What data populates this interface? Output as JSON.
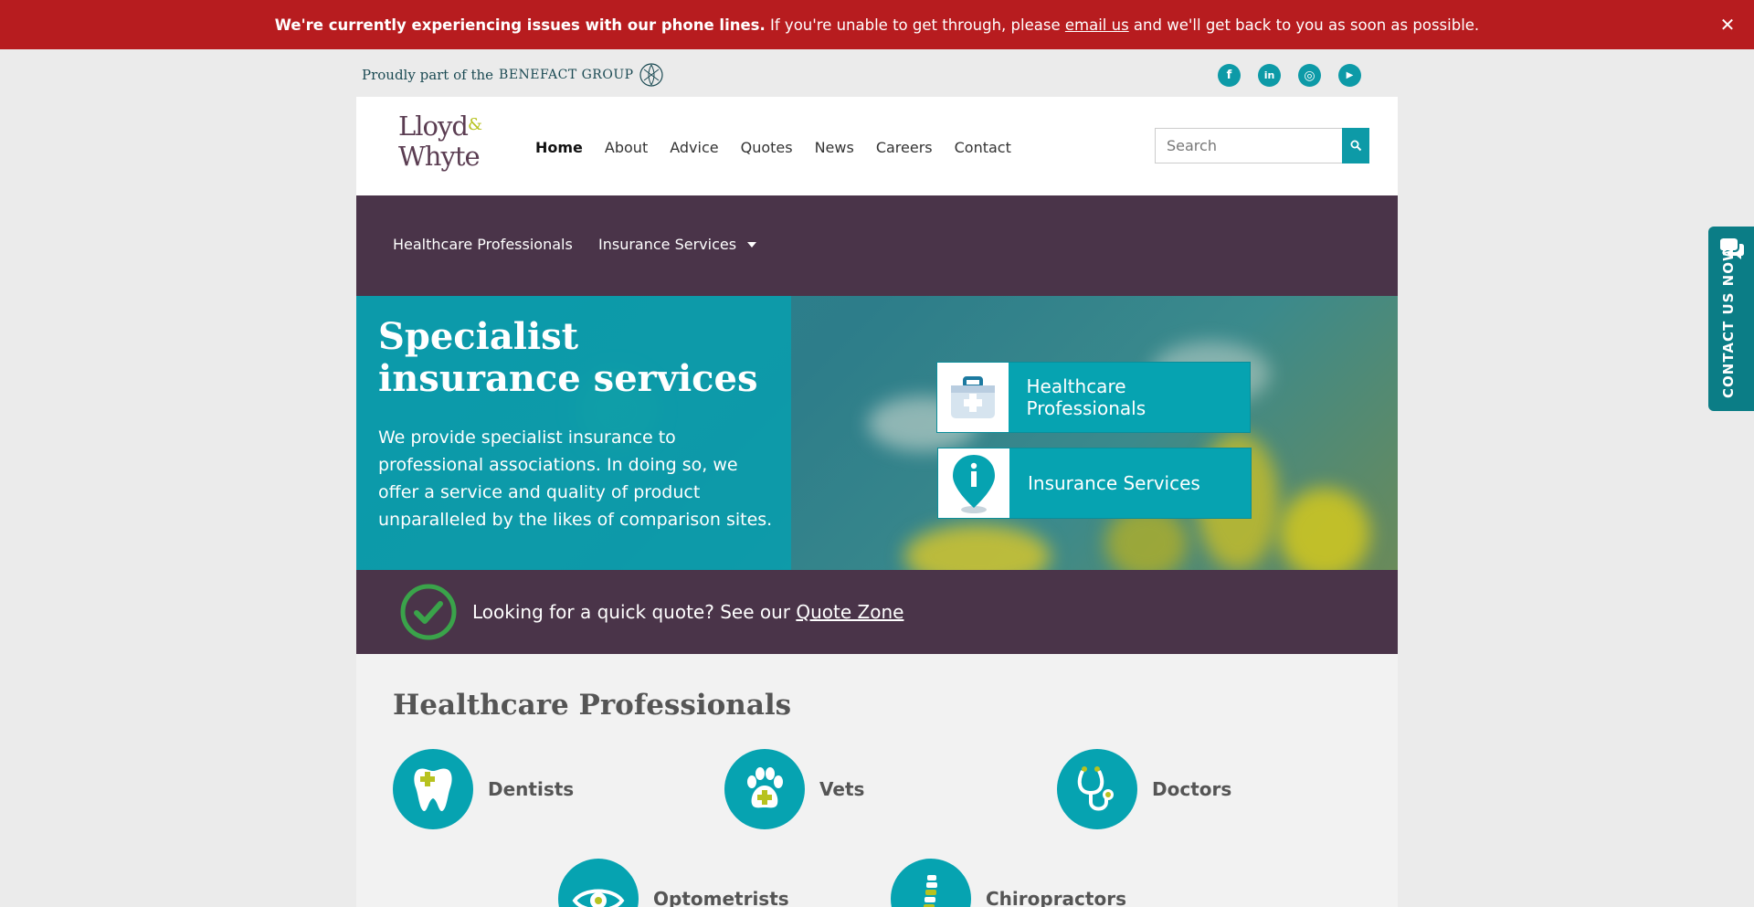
{
  "alert": {
    "bold_text": "We're currently experiencing issues with our phone lines.",
    "text_before_link": " If you're unable to get through, please ",
    "link_text": "email us",
    "text_after_link": " and we'll get back to you as soon as possible.",
    "close_icon": "close-icon"
  },
  "topstrip": {
    "group_prefix": "Proudly part of the",
    "group_name": "BENEFACT GROUP",
    "socials": [
      {
        "name": "facebook-icon",
        "glyph": "f"
      },
      {
        "name": "linkedin-icon",
        "glyph": "in"
      },
      {
        "name": "instagram-icon",
        "glyph": "◎"
      },
      {
        "name": "youtube-icon",
        "glyph": "▶"
      }
    ]
  },
  "header": {
    "logo_line1": "Lloyd",
    "logo_amp": "&",
    "logo_line2": "Whyte",
    "nav": [
      "Home",
      "About",
      "Advice",
      "Quotes",
      "News",
      "Careers",
      "Contact"
    ],
    "active_nav": "Home",
    "search_placeholder": "Search"
  },
  "subnav": {
    "item1": "Healthcare Professionals",
    "item2": "Insurance Services"
  },
  "hero": {
    "title": "Specialist insurance services",
    "text": "We provide specialist insurance to professional associations. In doing so, we offer a service and quality of product unparalleled by the likes of comparison sites.",
    "tile1": "Healthcare Professionals",
    "tile2": "Insurance Services"
  },
  "quote": {
    "text": "Looking for a quick quote? See our ",
    "link": "Quote Zone"
  },
  "section": {
    "title": "Healthcare Professionals",
    "items": [
      "Dentists",
      "Vets",
      "Doctors",
      "Optometrists",
      "Chiropractors"
    ]
  },
  "sidetab": {
    "label": "CONTACT US NOW"
  },
  "colors": {
    "alert_red": "#b71c1f",
    "teal": "#06a3b1",
    "plum": "#4a3449",
    "lime": "#b7c21f"
  }
}
